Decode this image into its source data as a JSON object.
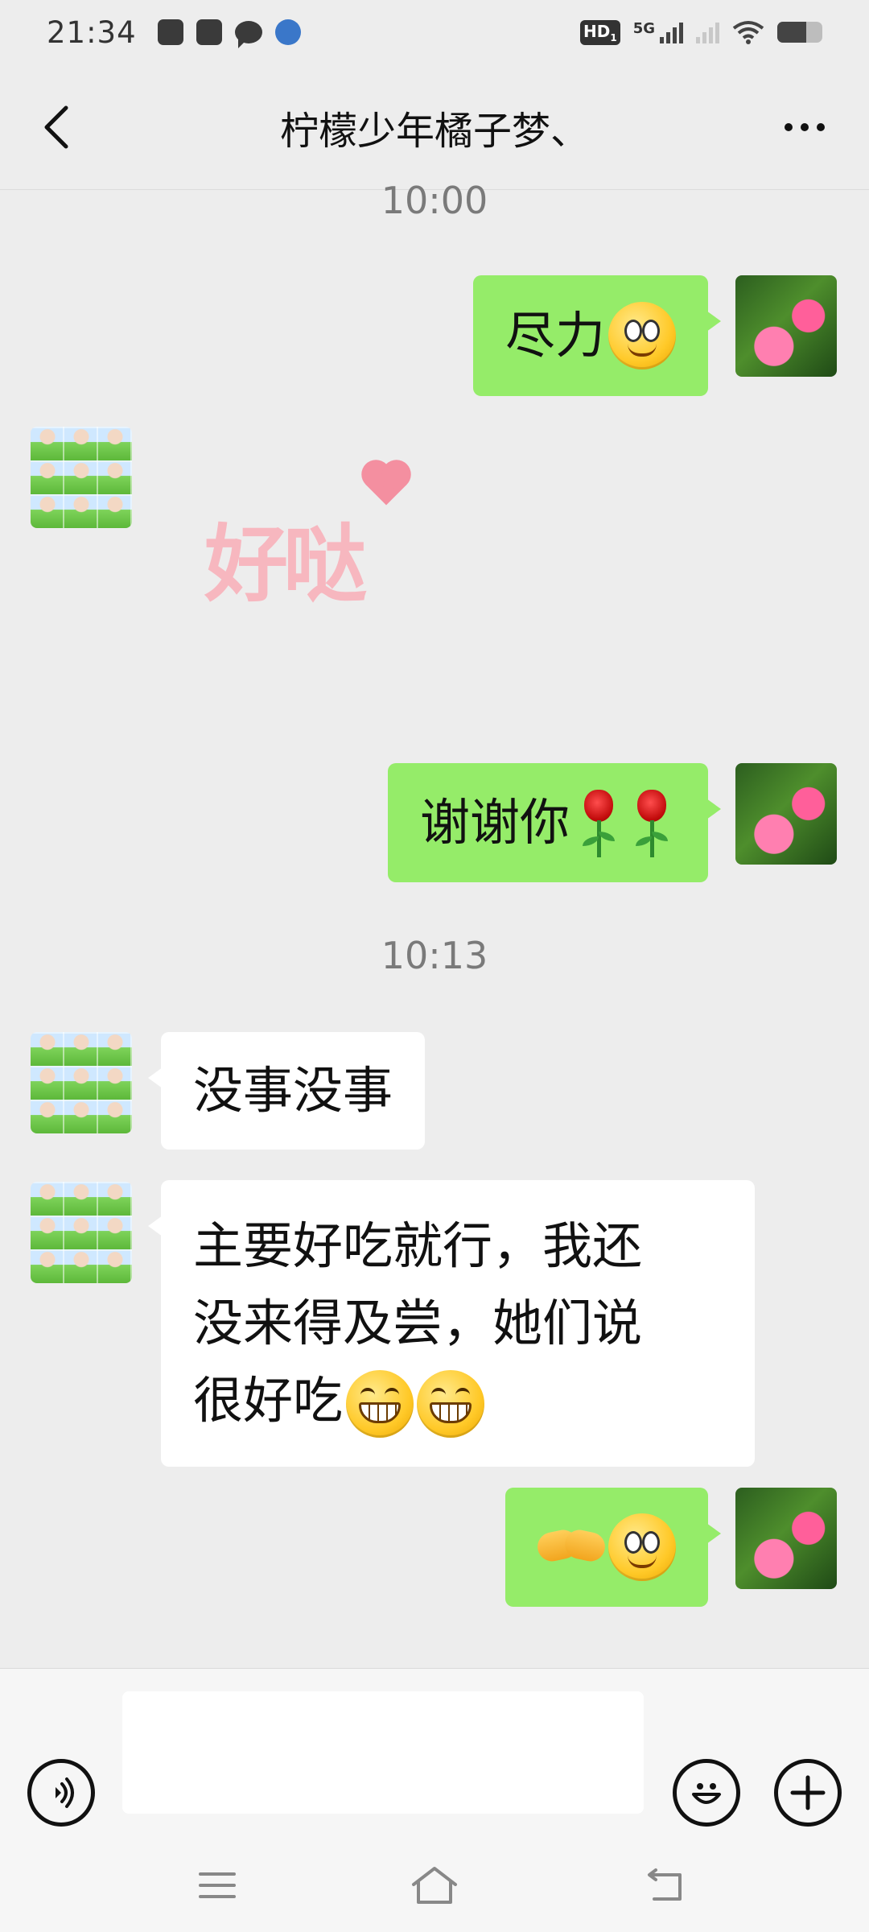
{
  "status_bar": {
    "time": "21:34",
    "network_badge": "HD",
    "network_sub": "1",
    "network_type": "5G",
    "left_icons": [
      "scissors-app-icon",
      "shop-bag-icon",
      "chat-bubble-icon",
      "weibo-icon"
    ],
    "battery_level": 0.65
  },
  "header": {
    "back_icon": "chevron-left-icon",
    "title": "柠檬少年橘子梦、",
    "more_icon": "more-horizontal-icon"
  },
  "messages": {
    "ts1": "10:00",
    "m1": {
      "sender": "me",
      "text": "尽力",
      "emoji": "slight-smile"
    },
    "m2": {
      "sender": "them",
      "sticker_text": "好哒",
      "sticker_icon": "heart-icon"
    },
    "m3": {
      "sender": "me",
      "text": "谢谢你",
      "emoji": [
        "rose",
        "rose"
      ]
    },
    "ts2": "10:13",
    "m4": {
      "sender": "them",
      "text": "没事没事"
    },
    "m5": {
      "sender": "them",
      "line1": "主要好吃就行，我还",
      "line2": "没来得及尝，她们说",
      "line3": "很好吃",
      "emoji": [
        "grin",
        "grin"
      ]
    },
    "m6": {
      "sender": "me",
      "emoji": [
        "handshake",
        "slight-smile"
      ]
    }
  },
  "input_bar": {
    "voice_icon": "voice-icon",
    "input_value": "",
    "emoji_icon": "emoji-icon",
    "plus_icon": "plus-icon"
  },
  "nav_bar": {
    "menu_icon": "menu-icon",
    "home_icon": "home-icon",
    "back_icon": "back-icon"
  },
  "colors": {
    "my_bubble": "#95ec69",
    "their_bubble": "#ffffff",
    "background": "#ededed"
  }
}
